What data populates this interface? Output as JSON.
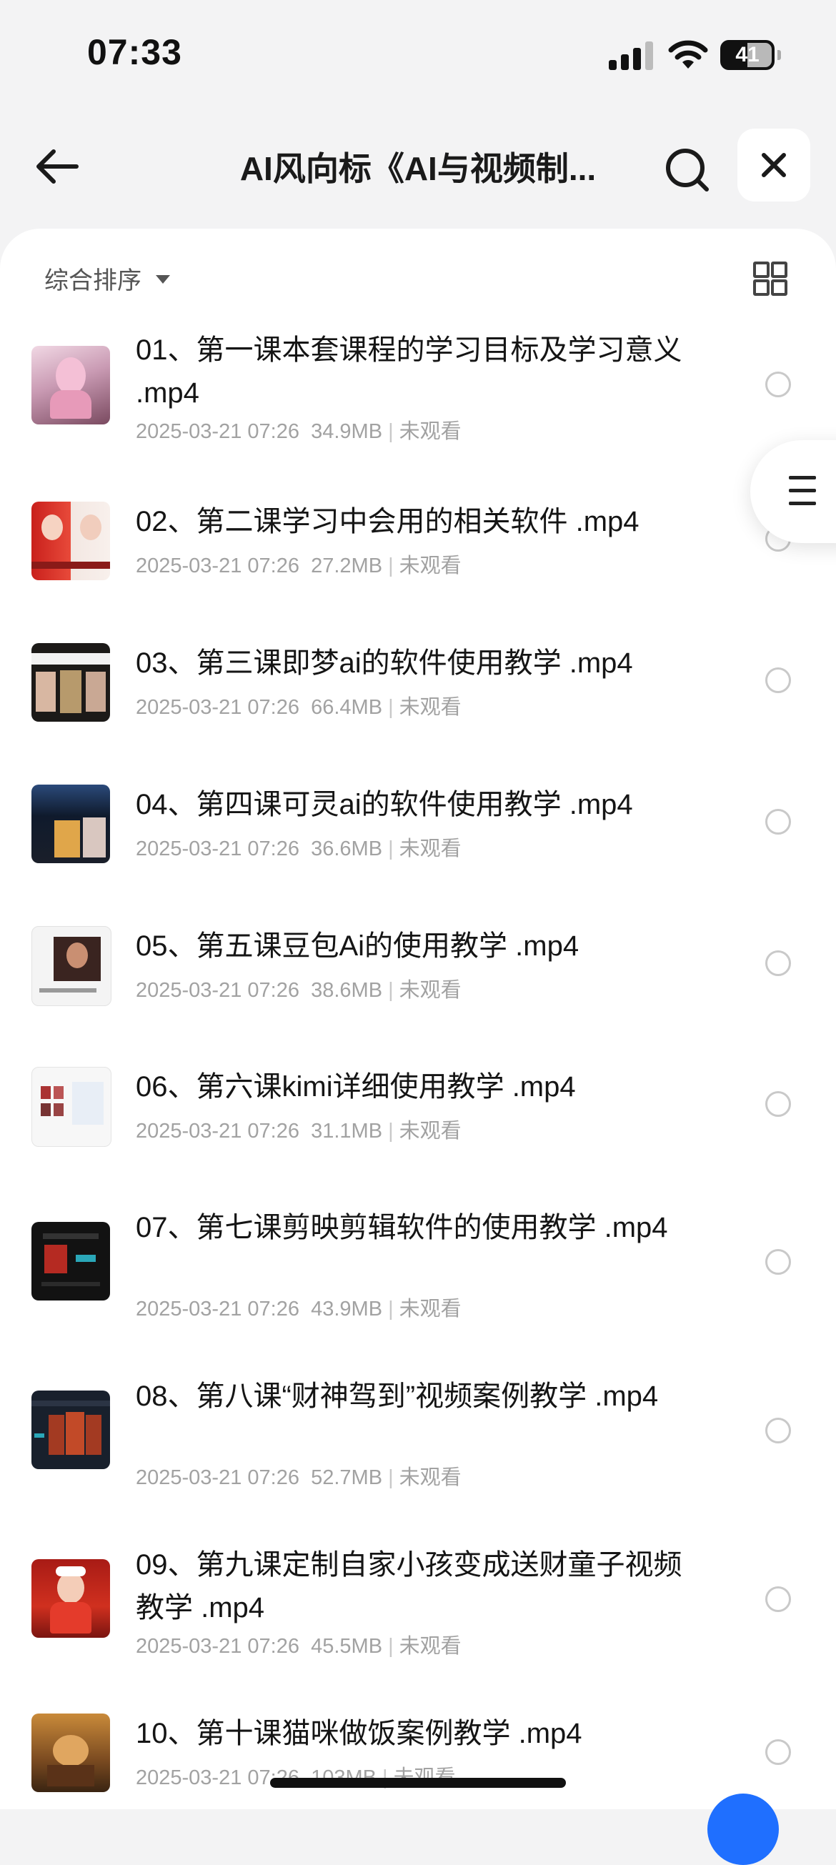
{
  "status_bar": {
    "time": "07:33",
    "battery": "41"
  },
  "nav": {
    "title": "AI风向标《AI与视频制..."
  },
  "toolbar": {
    "sort_label": "综合排序"
  },
  "files": [
    {
      "name": "01、第一课本套课程的学习目标及学习意义 .mp4",
      "date": "2025-03-21 07:26",
      "size": "34.9MB",
      "status": "未观看"
    },
    {
      "name": "02、第二课学习中会用的相关软件 .mp4",
      "date": "2025-03-21 07:26",
      "size": "27.2MB",
      "status": "未观看"
    },
    {
      "name": "03、第三课即梦ai的软件使用教学 .mp4",
      "date": "2025-03-21 07:26",
      "size": "66.4MB",
      "status": "未观看"
    },
    {
      "name": "04、第四课可灵ai的软件使用教学 .mp4",
      "date": "2025-03-21 07:26",
      "size": "36.6MB",
      "status": "未观看"
    },
    {
      "name": "05、第五课豆包Ai的使用教学 .mp4",
      "date": "2025-03-21 07:26",
      "size": "38.6MB",
      "status": "未观看"
    },
    {
      "name": "06、第六课kimi详细使用教学 .mp4",
      "date": "2025-03-21 07:26",
      "size": "31.1MB",
      "status": "未观看"
    },
    {
      "name": "07、第七课剪映剪辑软件的使用教学 .mp4",
      "date": "2025-03-21 07:26",
      "size": "43.9MB",
      "status": "未观看"
    },
    {
      "name": "08、第八课“财神驾到”视频案例教学 .mp4",
      "date": "2025-03-21 07:26",
      "size": "52.7MB",
      "status": "未观看"
    },
    {
      "name": "09、第九课定制自家小孩变成送财童子视频教学 .mp4",
      "date": "2025-03-21 07:26",
      "size": "45.5MB",
      "status": "未观看"
    },
    {
      "name": "10、第十课猫咪做饭案例教学 .mp4",
      "date": "2025-03-21 07:26",
      "size": "103MB",
      "status": "未观看"
    }
  ]
}
